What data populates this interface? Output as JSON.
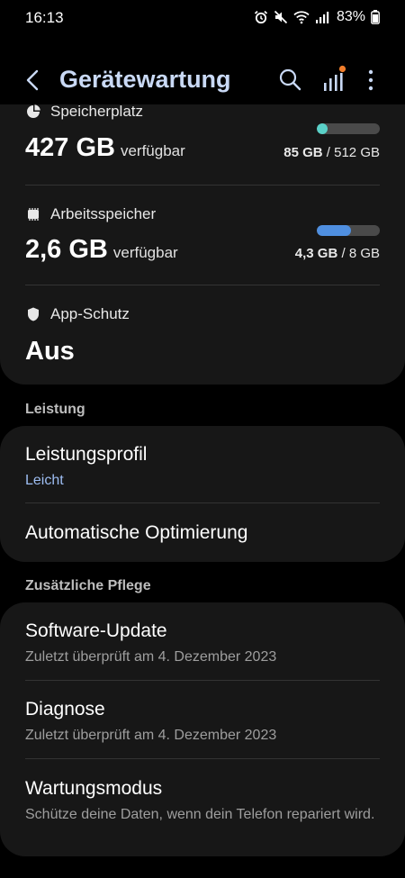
{
  "status": {
    "time": "16:13",
    "battery": "83%"
  },
  "app_bar": {
    "title": "Gerätewartung"
  },
  "storage": {
    "label": "Speicherplatz",
    "value": "427 GB",
    "available_label": "verfügbar",
    "used": "85 GB",
    "separator": " / ",
    "total": "512 GB",
    "fill_fraction": 0.166,
    "color": "#5ad1c8"
  },
  "memory": {
    "label": "Arbeitsspeicher",
    "value": "2,6 GB",
    "available_label": "verfügbar",
    "used": "4,3 GB",
    "separator": " / ",
    "total": "8 GB",
    "fill_fraction": 0.54,
    "color": "#4f8fe0"
  },
  "app_protection": {
    "label": "App-Schutz",
    "value": "Aus"
  },
  "performance": {
    "group_title": "Leistung",
    "items": [
      {
        "title": "Leistungsprofil",
        "subtitle": "Leicht"
      },
      {
        "title": "Automatische Optimierung"
      }
    ]
  },
  "extra_care": {
    "group_title": "Zusätzliche Pflege",
    "items": [
      {
        "title": "Software-Update",
        "subtitle": "Zuletzt überprüft am 4. Dezember 2023"
      },
      {
        "title": "Diagnose",
        "subtitle": "Zuletzt überprüft am 4. Dezember 2023"
      },
      {
        "title": "Wartungsmodus",
        "subtitle": "Schütze deine Daten, wenn dein Telefon repariert wird."
      }
    ]
  },
  "colors": {
    "accent": "#9dbdf2",
    "notification_dot": "#f07d2b"
  }
}
